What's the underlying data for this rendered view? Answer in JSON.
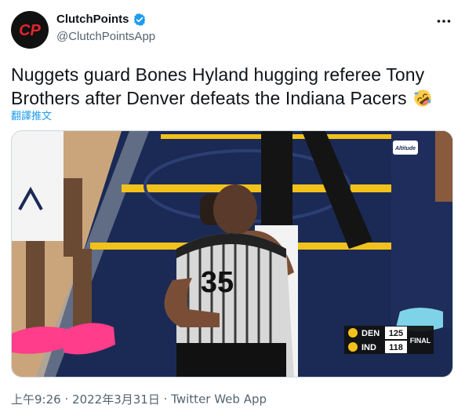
{
  "author": {
    "name": "ClutchPoints",
    "handle": "@ClutchPointsApp",
    "avatar_text": "CP",
    "verified_icon": "verified-badge-icon"
  },
  "tweet": {
    "text": "Nuggets guard Bones Hyland hugging referee Tony Brothers after Denver defeats the Indiana Pacers",
    "emoji": "rolling-on-floor-laughing-emoji",
    "translate_label": "翻譯推文"
  },
  "media": {
    "scoreboard": {
      "team1": "DEN",
      "score1": "125",
      "team2": "IND",
      "score2": "118",
      "status": "FINAL"
    },
    "jersey_number": "35",
    "sponsor_sign": "Altitude"
  },
  "meta": {
    "time": "上午9:26",
    "separator1": "·",
    "date": "2022年3月31日",
    "separator2": "·",
    "source": "Twitter Web App"
  },
  "colors": {
    "link_blue": "#1d9bf0",
    "text": "#0f1419",
    "secondary": "#536471",
    "court_navy": "#1b2a55",
    "court_yellow": "#f2c21b"
  }
}
